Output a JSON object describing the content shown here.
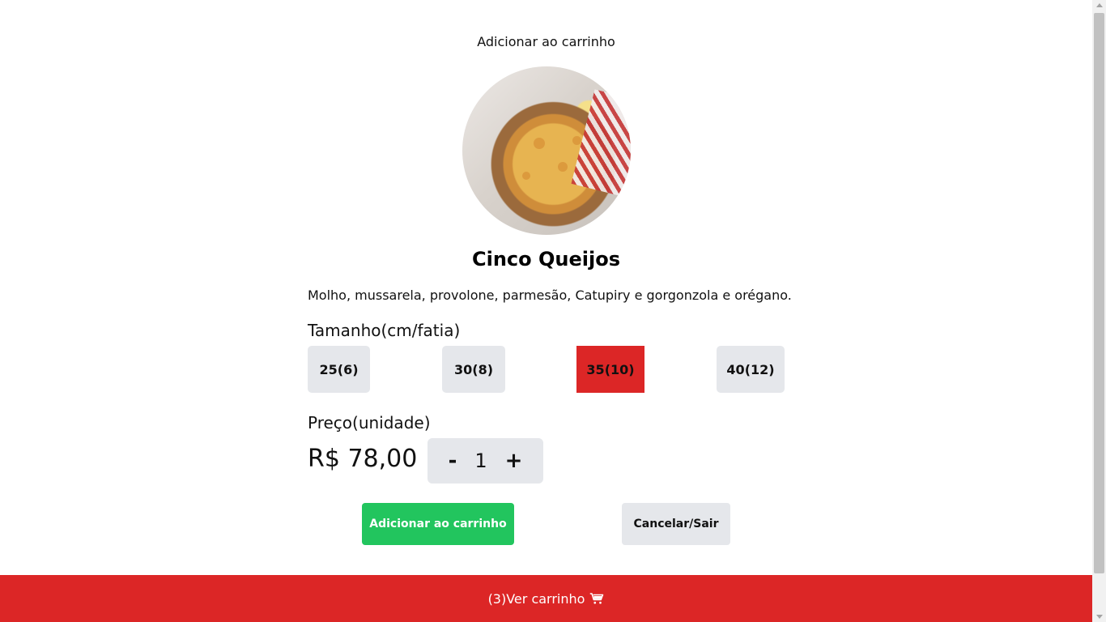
{
  "modal": {
    "title": "Adicionar ao carrinho",
    "product_image_alt": "pizza-photo"
  },
  "product": {
    "name": "Cinco Queijos",
    "description": "Molho, mussarela, provolone, parmesão, Catupiry e gorgonzola e orégano."
  },
  "sizes": {
    "label": "Tamanho(cm/fatia)",
    "options": [
      "25(6)",
      "30(8)",
      "35(10)",
      "40(12)"
    ],
    "selected": "35(10)"
  },
  "price": {
    "label": "Preço(unidade)",
    "value": "R$ 78,00"
  },
  "quantity": {
    "minus": "-",
    "value": "1",
    "plus": "+"
  },
  "actions": {
    "add": "Adicionar ao carrinho",
    "cancel": "Cancelar/Sair"
  },
  "cart_bar": {
    "text": "(3)Ver carrinho",
    "icon": "cart-icon"
  },
  "colors": {
    "accent_red": "#dc2626",
    "success_green": "#22c55e",
    "neutral_button": "#e5e7eb"
  }
}
